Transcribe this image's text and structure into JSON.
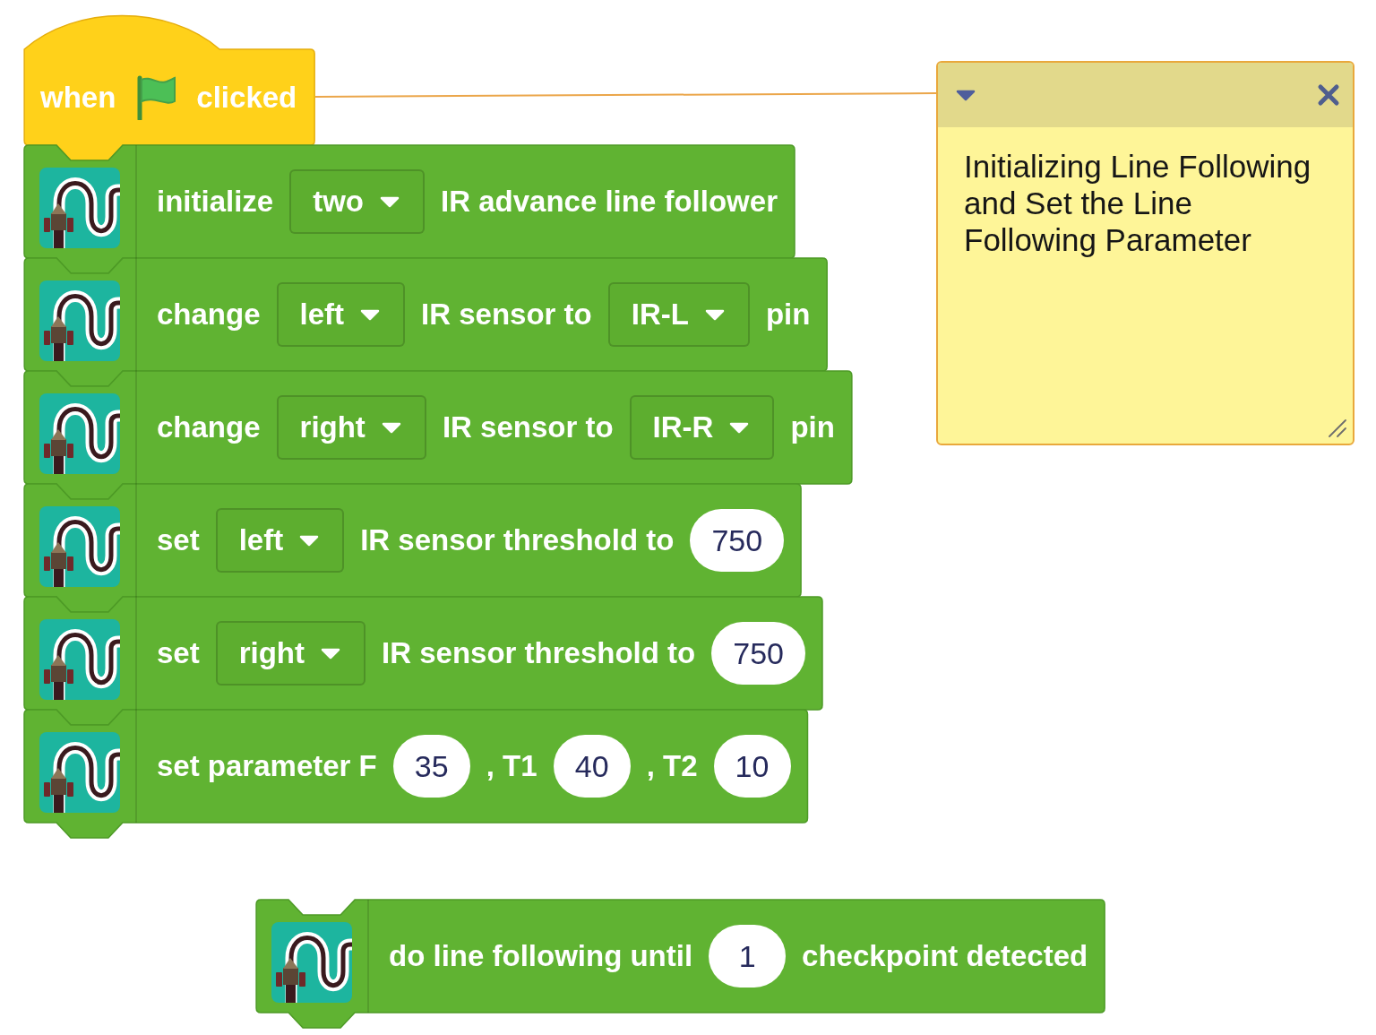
{
  "scripts": [
    {
      "blocks": [
        {
          "kind": "hat",
          "parts": [
            {
              "kind": "label",
              "text": "when"
            },
            {
              "kind": "icon"
            },
            {
              "kind": "label",
              "text": "clicked"
            }
          ]
        },
        {
          "kind": "command",
          "parts": [
            {
              "kind": "label",
              "text": "initialize"
            },
            {
              "kind": "dropdown",
              "text": "two"
            },
            {
              "kind": "label",
              "text": "IR advance line follower"
            }
          ]
        },
        {
          "kind": "command",
          "parts": [
            {
              "kind": "label",
              "text": "change"
            },
            {
              "kind": "dropdown",
              "text": "left"
            },
            {
              "kind": "label",
              "text": "IR sensor to"
            },
            {
              "kind": "dropdown",
              "text": "IR-L"
            },
            {
              "kind": "label",
              "text": "pin"
            }
          ]
        },
        {
          "kind": "command",
          "parts": [
            {
              "kind": "label",
              "text": "change"
            },
            {
              "kind": "dropdown",
              "text": "right"
            },
            {
              "kind": "label",
              "text": "IR sensor to"
            },
            {
              "kind": "dropdown",
              "text": "IR-R"
            },
            {
              "kind": "label",
              "text": "pin"
            }
          ]
        },
        {
          "kind": "command",
          "parts": [
            {
              "kind": "label",
              "text": "set"
            },
            {
              "kind": "dropdown",
              "text": "left"
            },
            {
              "kind": "label",
              "text": "IR sensor threshold to"
            },
            {
              "kind": "number",
              "text": "750"
            }
          ]
        },
        {
          "kind": "command",
          "parts": [
            {
              "kind": "label",
              "text": "set"
            },
            {
              "kind": "dropdown",
              "text": "right"
            },
            {
              "kind": "label",
              "text": "IR sensor threshold to"
            },
            {
              "kind": "number",
              "text": "750"
            }
          ]
        },
        {
          "kind": "command",
          "parts": [
            {
              "kind": "label",
              "text": "set parameter F"
            },
            {
              "kind": "number",
              "text": "35"
            },
            {
              "kind": "label",
              "text": ", T1"
            },
            {
              "kind": "number",
              "text": "40"
            },
            {
              "kind": "label",
              "text": ", T2"
            },
            {
              "kind": "number",
              "text": "10"
            }
          ]
        }
      ]
    },
    {
      "blocks": [
        {
          "kind": "command",
          "parts": [
            {
              "kind": "label",
              "text": "do line following until"
            },
            {
              "kind": "number",
              "text": "1"
            },
            {
              "kind": "label",
              "text": "checkpoint detected"
            }
          ]
        }
      ]
    }
  ],
  "comment": {
    "expanded": true,
    "text": "Initializing Line Following and Set the Line Following Parameter"
  }
}
